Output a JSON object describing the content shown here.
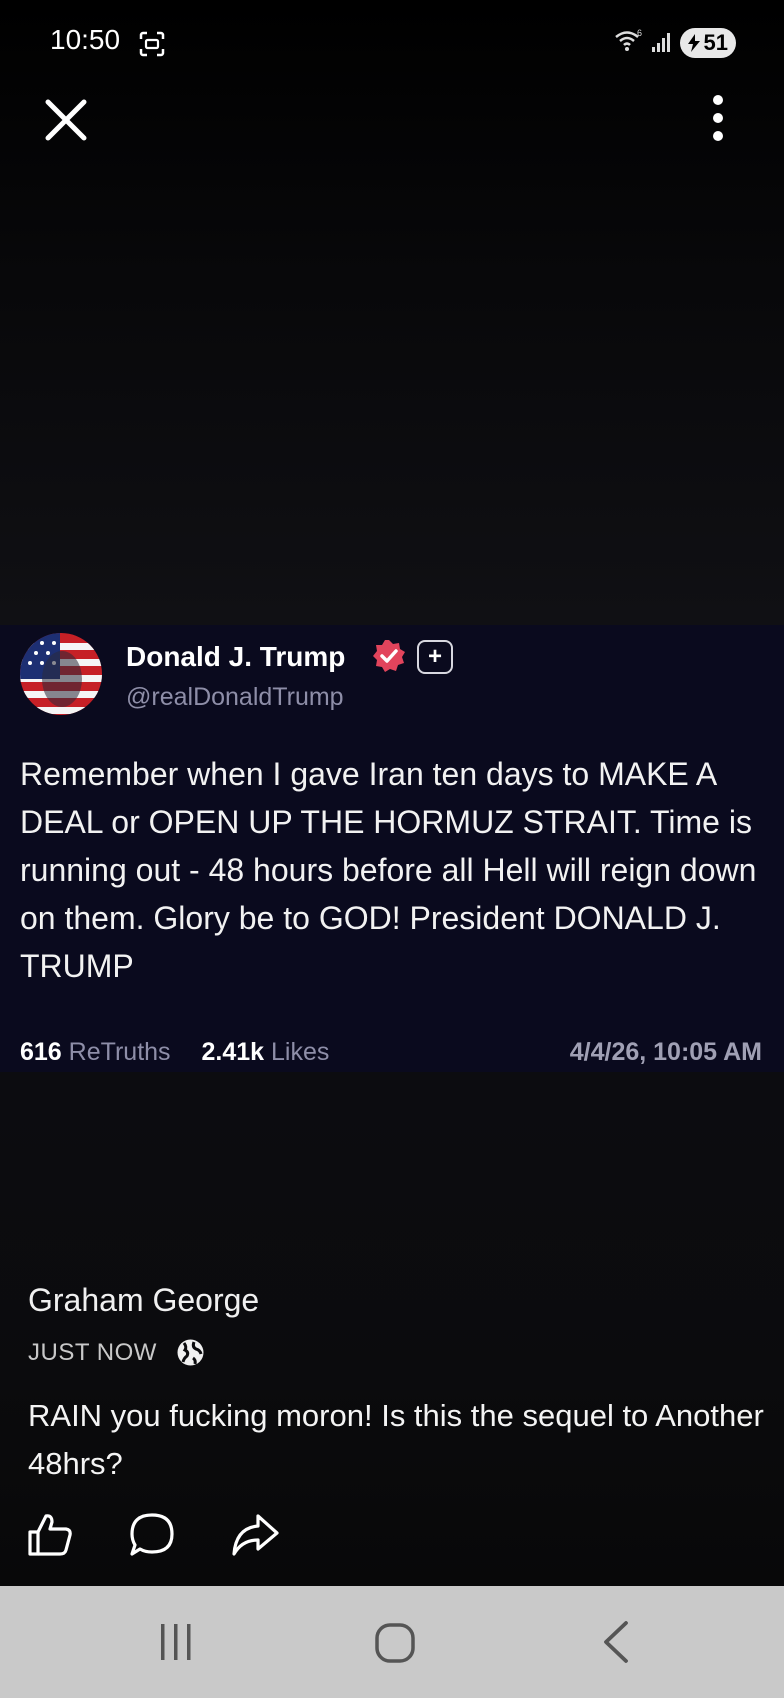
{
  "status_bar": {
    "time": "10:50",
    "battery": "51",
    "icons": [
      "screenshot-icon",
      "wifi-icon",
      "signal-icon",
      "battery-icon"
    ]
  },
  "toolbar": {
    "icons": [
      "close-icon",
      "more-vert-icon"
    ]
  },
  "post": {
    "author_name": "Donald J. Trump",
    "handle": "@realDonaldTrump",
    "plus_badge": "+",
    "body": "Remember when I gave Iran ten days to MAKE A DEAL or OPEN UP THE HORMUZ STRAIT. Time is running out - 48 hours before all Hell will reign down on them. Glory be to GOD! President DONALD J. TRUMP",
    "retruths_count": "616",
    "retruths_label": "ReTruths",
    "likes_count": "2.41k",
    "likes_label": "Likes",
    "date": "4/4/26, 10:05 AM",
    "colors": {
      "card_bg": "#0a0a1e",
      "verified": "#e2445c",
      "muted": "#8e8ea8"
    }
  },
  "comment": {
    "author": "Graham George",
    "time": "JUST NOW",
    "text": "RAIN you fucking moron! Is this the sequel to Another 48hrs?",
    "actions": [
      "like-icon",
      "comment-icon",
      "share-icon"
    ]
  },
  "nav_bar": {
    "icons": [
      "recent-apps-icon",
      "home-icon",
      "back-icon"
    ]
  }
}
